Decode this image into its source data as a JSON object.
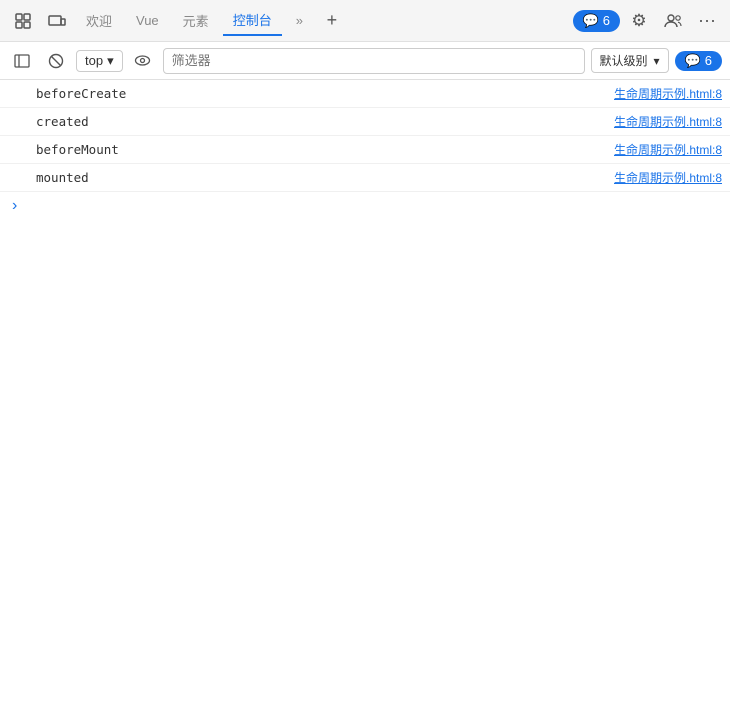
{
  "topNav": {
    "icons": [
      {
        "name": "inspect-icon",
        "glyph": "⬚"
      },
      {
        "name": "responsive-icon",
        "glyph": "⊞"
      }
    ],
    "tabs": [
      {
        "label": "欢迎",
        "active": false
      },
      {
        "label": "Vue",
        "active": false
      },
      {
        "label": "元素",
        "active": false
      },
      {
        "label": "控制台",
        "active": true
      },
      {
        "label": "»",
        "active": false
      }
    ],
    "addTabIcon": "+",
    "badge": {
      "icon": "💬",
      "count": "6"
    },
    "settingsIcon": "⚙",
    "usersIcon": "👥",
    "dotsIcon": "···"
  },
  "toolbar": {
    "sidebarToggleIcon": "▤",
    "blockIcon": "⊘",
    "contextDropdown": {
      "value": "top",
      "arrow": "▾"
    },
    "eyeIcon": "◎",
    "filterPlaceholder": "筛选器",
    "levelDropdown": {
      "label": "默认级别",
      "arrow": "▾"
    },
    "badge": {
      "icon": "💬",
      "count": "6"
    }
  },
  "logs": [
    {
      "text": "beforeCreate",
      "source": "生命周期示例.html:8",
      "hasExpand": false
    },
    {
      "text": "created",
      "source": "生命周期示例.html:8",
      "hasExpand": false
    },
    {
      "text": "beforeMount",
      "source": "生命周期示例.html:8",
      "hasExpand": false
    },
    {
      "text": "mounted",
      "source": "生命周期示例.html:8",
      "hasExpand": false
    }
  ],
  "expandRow": {
    "chevron": "›"
  }
}
